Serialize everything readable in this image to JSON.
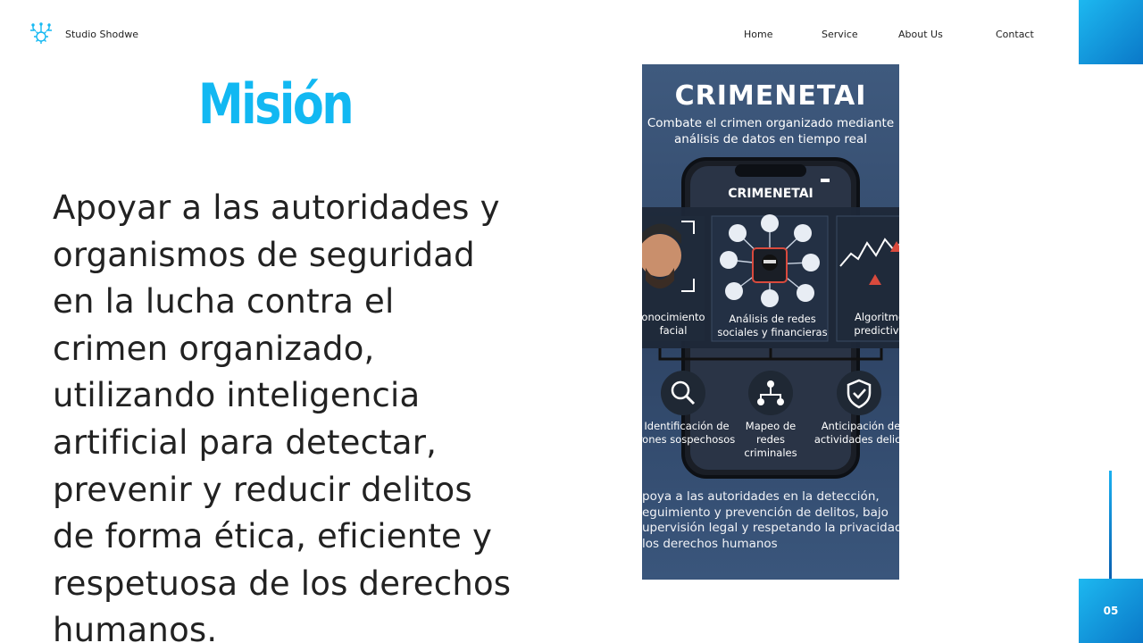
{
  "header": {
    "brand": "Studio Shodwe",
    "logo_icon": "circuit-gear-icon",
    "nav": [
      "Home",
      "Service",
      "About Us",
      "Contact"
    ]
  },
  "slide": {
    "title": "Misión",
    "body": "Apoyar a las autoridades y organismos de seguridad en la lucha contra el crimen organizado, utilizando inteligencia artificial para detectar, prevenir y reducir delitos de forma ética, eficiente y respetuosa de los derechos humanos.",
    "page_number": "05"
  },
  "infographic": {
    "title": "CRIMENETAI",
    "subtitle_line1": "Combate el crimen organizado mediante",
    "subtitle_line2": "análisis de datos en tiempo real",
    "phone_title": "CRIMENETAI",
    "cards": [
      {
        "line1": "onocimiento",
        "line2": "facial"
      },
      {
        "line1": "Análisis de redes",
        "line2": "sociales y financieras"
      },
      {
        "line1": "Algoritmo",
        "line2": "predictivo"
      }
    ],
    "features": [
      {
        "lines": [
          "Identificación de",
          "rones sospechosos"
        ],
        "icon": "search-person-icon"
      },
      {
        "lines": [
          "Mapeo de",
          "redes",
          "criminales"
        ],
        "icon": "network-map-icon"
      },
      {
        "lines": [
          "Anticipación de",
          "actividades delicti"
        ],
        "icon": "shield-check-icon"
      }
    ],
    "bottom_lines": [
      "poya a las autoridades en la detección,",
      "eguimiento y prevención de delitos, bajo",
      "upervisión legal y respetando la privacidad",
      "los derechos humanos"
    ],
    "colors": {
      "accent": "#12b8f2",
      "alert": "#d94a3d"
    }
  }
}
